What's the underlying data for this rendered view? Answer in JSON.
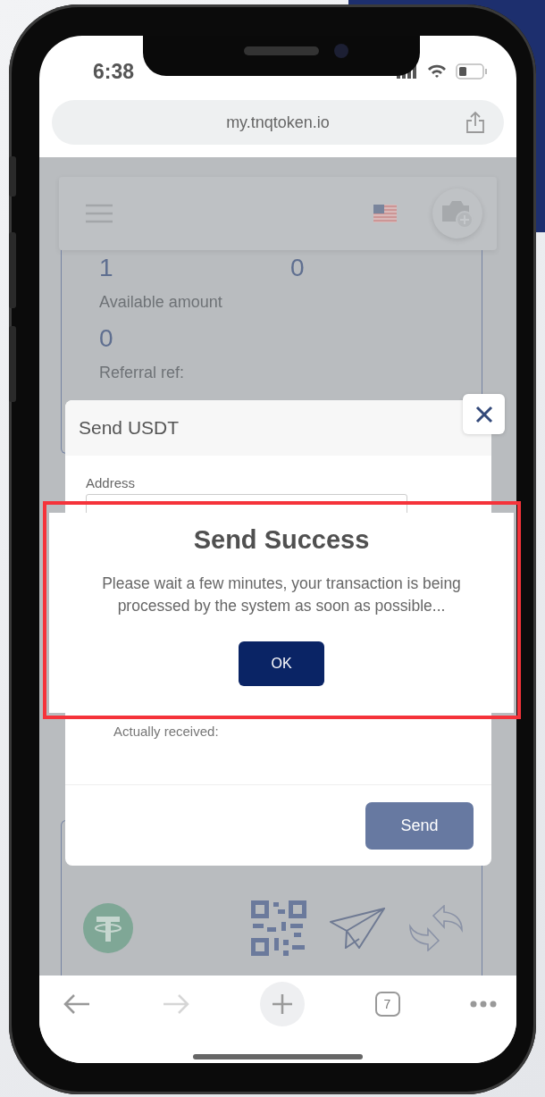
{
  "status_bar": {
    "time": "6:38"
  },
  "browser": {
    "url": "my.tnqtoken.io",
    "tab_count": "7",
    "forward_disabled": true
  },
  "page": {
    "stats": [
      {
        "value": "1"
      },
      {
        "value": "0"
      }
    ],
    "available_label": "Available amount",
    "available_value": "0",
    "referral_label": "Referral ref:"
  },
  "send_modal": {
    "title": "Send USDT",
    "address_label": "Address",
    "received_label": "Actually received:",
    "send_button": "Send"
  },
  "success_dialog": {
    "title": "Send Success",
    "message": "Please wait a few minutes, your transaction is being processed by the system as soon as possible...",
    "button": "OK"
  }
}
